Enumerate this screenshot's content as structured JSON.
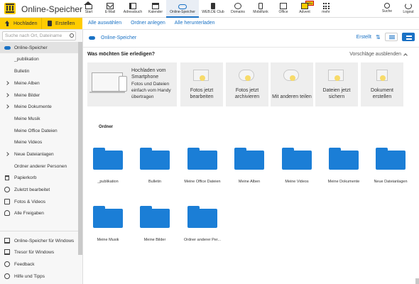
{
  "app": {
    "title": "Online-Speicher"
  },
  "nav": {
    "items": [
      {
        "label": "Start",
        "icon": "home-icon"
      },
      {
        "label": "E-Mail",
        "icon": "mail-icon"
      },
      {
        "label": "Adressbuch",
        "icon": "addressbook-icon"
      },
      {
        "label": "Kalender",
        "icon": "calendar-icon"
      },
      {
        "label": "Online-Speicher",
        "icon": "cloud-icon",
        "active": true
      },
      {
        "label": "WEB.DE Club",
        "icon": "club-icon"
      },
      {
        "label": "Domains",
        "icon": "globe-icon"
      },
      {
        "label": "Mobilfunk",
        "icon": "phone-icon"
      },
      {
        "label": "Office",
        "icon": "office-icon"
      },
      {
        "label": "Advent",
        "icon": "advent-icon",
        "badge": "NEU"
      },
      {
        "label": "mehr",
        "icon": "grid-icon"
      }
    ],
    "right": [
      {
        "label": "Suche",
        "icon": "search-icon"
      },
      {
        "label": "Logout",
        "icon": "power-icon"
      }
    ]
  },
  "toolbar": {
    "upload_label": "Hochladen",
    "create_label": "Erstellen",
    "links": [
      "Alle auswählen",
      "Ordner anlegen",
      "Alle herunterladen"
    ]
  },
  "sidebar": {
    "search_placeholder": "Suche nach Ort, Dateiname",
    "items": [
      {
        "label": "Online-Speicher",
        "icon": "cloud-icon",
        "active": true
      },
      {
        "label": "_publikation"
      },
      {
        "label": "Bulletin"
      },
      {
        "label": "Meine Alben",
        "chevron": true
      },
      {
        "label": "Meine Bilder",
        "chevron": true
      },
      {
        "label": "Meine Dokumente",
        "chevron": true
      },
      {
        "label": "Meine Musik"
      },
      {
        "label": "Meine Office Dateien"
      },
      {
        "label": "Meine Videos"
      },
      {
        "label": "Neue Dateianlagen",
        "chevron": true
      },
      {
        "label": "Ordner anderer Personen"
      },
      {
        "label": "Papierkorb",
        "icon": "trash-icon"
      },
      {
        "label": "Zuletzt bearbeitet",
        "icon": "clock-icon"
      },
      {
        "label": "Fotos & Videos",
        "icon": "photo-icon"
      },
      {
        "label": "Alle Freigaben",
        "icon": "people-icon"
      }
    ],
    "bottom": [
      {
        "label": "Online-Speicher für Windows",
        "icon": "desktop-icon"
      },
      {
        "label": "Tresor für Windows",
        "icon": "shield-icon"
      },
      {
        "label": "Feedback",
        "icon": "info-icon"
      },
      {
        "label": "Hilfe und Tipps",
        "icon": "help-icon"
      }
    ]
  },
  "main": {
    "breadcrumb": "Online-Speicher",
    "sort_label": "Erstellt",
    "suggestions": {
      "title": "Was möchten Sie erledigen?",
      "hide_label": "Vorschläge ausblenden",
      "upload_title": "Hochladen vom Smartphone",
      "upload_text": "Fotos und Dateien einfach vom Handy übertragen",
      "cards": [
        "Fotos jetzt bearbeiten",
        "Fotos jetzt archivieren",
        "Mit anderen teilen",
        "Dateien jetzt sichern",
        "Dokument erstellen"
      ]
    },
    "folders_title": "Ordner",
    "folders": [
      "_publikation",
      "Bulletin",
      "Meine Office Dateien",
      "Meine Alben",
      "Meine Videos",
      "Meine Dokumente",
      "Neue Dateianlagen",
      "Meine Musik",
      "Meine Bilder",
      "Ordner anderer Per..."
    ]
  },
  "colors": {
    "accent": "#ffcc00",
    "link": "#1a72c5",
    "folder": "#1b7ed6"
  }
}
